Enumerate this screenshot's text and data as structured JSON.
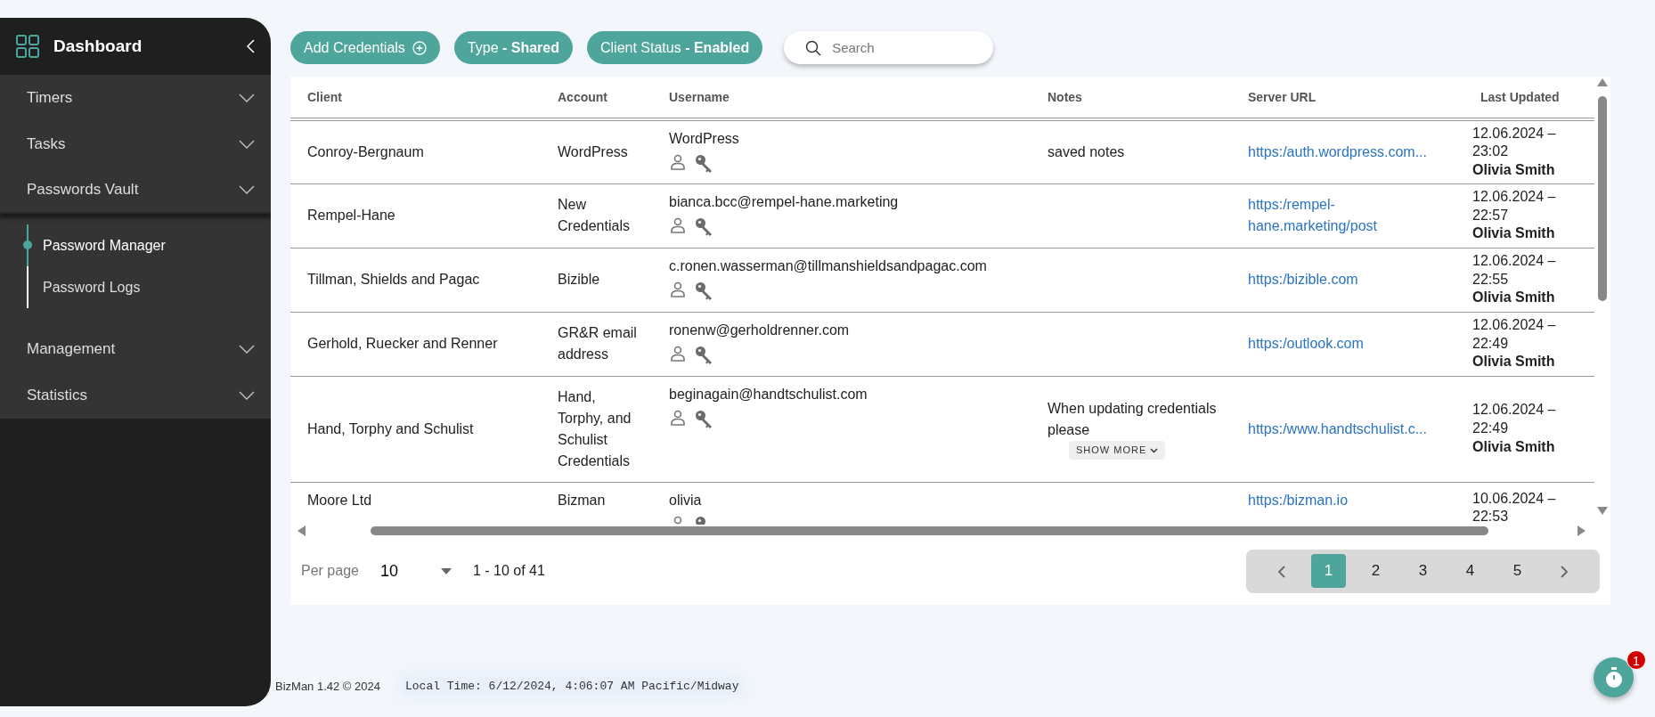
{
  "sidebar": {
    "title": "Dashboard",
    "items": [
      {
        "label": "Timers",
        "expanded": false
      },
      {
        "label": "Tasks",
        "expanded": false
      },
      {
        "label": "Passwords Vault",
        "expanded": true,
        "children": [
          {
            "label": "Password Manager",
            "selected": true
          },
          {
            "label": "Password Logs",
            "selected": false
          }
        ]
      },
      {
        "label": "Management",
        "expanded": false
      },
      {
        "label": "Statistics",
        "expanded": false
      }
    ]
  },
  "toolbar": {
    "add_button": "Add Credentials",
    "filters": [
      "Type **- Shared**",
      "Client Status **- Enabled**"
    ],
    "search": {
      "placeholder": "Search"
    }
  },
  "table": {
    "columns": [
      "Client",
      "Account",
      "Username",
      "Notes",
      "Server URL",
      "Last Updated"
    ],
    "rows": [
      {
        "client": "Conroy-Bergnaum",
        "account": "WordPress",
        "username": "WordPress",
        "notes": "saved notes",
        "server_url": "https:/auth.wordpress.com...",
        "updated": "12.06.2024 – 23:02",
        "updated_by": "Olivia Smith"
      },
      {
        "client": "Rempel-Hane",
        "account": "New Credentials",
        "username": "bianca.bcc@rempel-hane.marketing",
        "server_url": "https:/rempel-hane.marketing/post",
        "updated": "12.06.2024 – 22:57",
        "updated_by": "Olivia Smith"
      },
      {
        "client": "Tillman, Shields and Pagac",
        "account": "Bizible",
        "username": "c.ronen.wasserman@tillmanshieldsandpagac.com",
        "server_url": "https:/bizible.com",
        "updated": "12.06.2024 – 22:55",
        "updated_by": "Olivia Smith"
      },
      {
        "client": "Gerhold, Ruecker and Renner",
        "account": "GR&R email address",
        "username": "ronenw@gerholdrenner.com",
        "server_url": "https:/outlook.com",
        "updated": "12.06.2024 – 22:49",
        "updated_by": "Olivia Smith"
      },
      {
        "client": "Hand, Torphy and Schulist",
        "account": "Hand, Torphy, and Schulist Credentials",
        "username": "beginagain@handtschulist.com",
        "notes": "When updating credentials please",
        "show_more": "SHOW MORE",
        "server_url": "https:/www.handtschulist.c...",
        "updated": "12.06.2024 – 22:49",
        "updated_by": "Olivia Smith"
      },
      {
        "client": "Moore Ltd",
        "account": "Bizman",
        "username": "olivia",
        "server_url": "https:/bizman.io",
        "updated": "10.06.2024 – 22:53"
      }
    ]
  },
  "pagination": {
    "per_page_label": "Per page",
    "per_page": "10",
    "range": "1 - 10 of 41",
    "pages": [
      {
        "label": "1",
        "selected": true
      },
      {
        "label": "2",
        "selected": false
      },
      {
        "label": "3",
        "selected": false
      },
      {
        "label": "4",
        "selected": false
      },
      {
        "label": "5",
        "selected": false
      }
    ]
  },
  "footer": {
    "version": "BizMan 1.42 © 2024",
    "local_time": "Local Time: 6/12/2024, 4:06:07 AM Pacific/Midway"
  },
  "timer": {
    "badge": "1"
  }
}
